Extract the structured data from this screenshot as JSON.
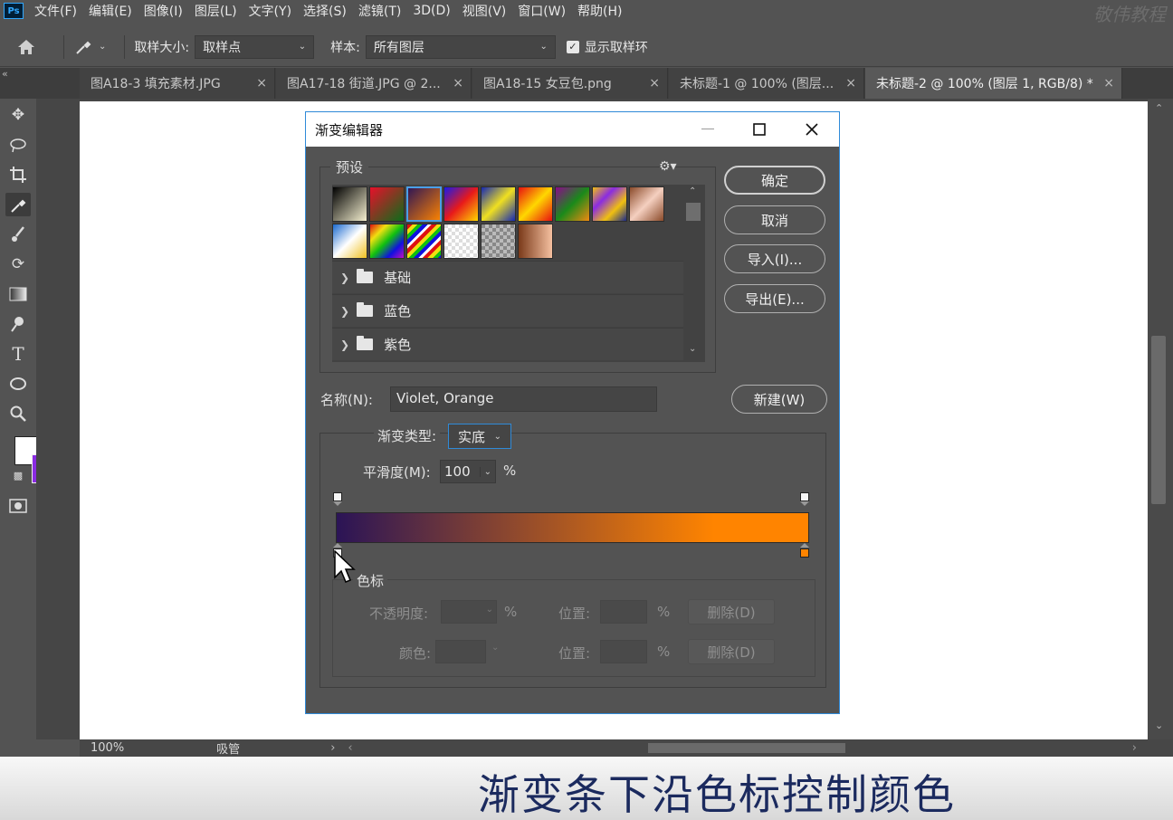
{
  "app": {
    "logo": "Ps",
    "watermark": "敬伟教程"
  },
  "menu": [
    "文件(F)",
    "编辑(E)",
    "图像(I)",
    "图层(L)",
    "文字(Y)",
    "选择(S)",
    "滤镜(T)",
    "3D(D)",
    "视图(V)",
    "窗口(W)",
    "帮助(H)"
  ],
  "options": {
    "sample_size_label": "取样大小:",
    "sample_size_value": "取样点",
    "sample_label": "样本:",
    "sample_value": "所有图层",
    "show_ring_label": "显示取样环",
    "show_ring_checked": true
  },
  "tabs": [
    {
      "label": "图A18-3 填充素材.JPG",
      "active": false
    },
    {
      "label": "图A17-18 街道.JPG @ 2...",
      "active": false
    },
    {
      "label": "图A18-15 女豆包.png",
      "active": false
    },
    {
      "label": "未标题-1 @ 100% (图层...",
      "active": false
    },
    {
      "label": "未标题-2 @ 100% (图层 1, RGB/8) *",
      "active": true
    }
  ],
  "colors": {
    "foreground": "#ffffff",
    "background": "#8a2be2",
    "gradient_start": "#2b1456",
    "gradient_end": "#ff8400"
  },
  "status": {
    "zoom": "100%",
    "tool": "吸管"
  },
  "dialog": {
    "title": "渐变编辑器",
    "presets_label": "预设",
    "folders": [
      "基础",
      "蓝色",
      "紫色"
    ],
    "buttons": {
      "ok": "确定",
      "cancel": "取消",
      "import": "导入(I)...",
      "export": "导出(E)...",
      "new": "新建(W)"
    },
    "name_label": "名称(N):",
    "name_value": "Violet, Orange",
    "gradient_type_label": "渐变类型:",
    "gradient_type_value": "实底",
    "smoothness_label": "平滑度(M):",
    "smoothness_value": "100",
    "smoothness_unit": "%",
    "stops_label": "色标",
    "opacity_label": "不透明度:",
    "percent": "%",
    "location_label": "位置:",
    "delete_label": "删除(D)",
    "color_label": "颜色:"
  },
  "caption": "渐变条下沿色标控制颜色"
}
